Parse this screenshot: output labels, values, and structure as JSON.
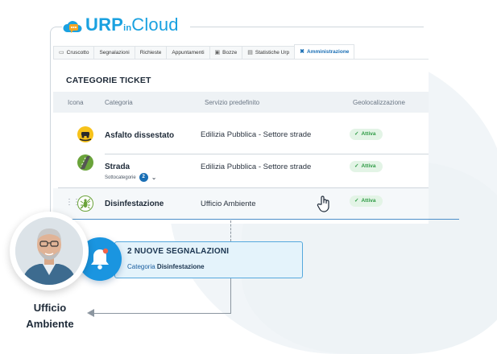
{
  "app": {
    "logo_urp": "URP",
    "logo_in": "in",
    "logo_cloud": "Cloud"
  },
  "tabs": [
    {
      "label": "Cruscotto",
      "icon": "monitor-icon"
    },
    {
      "label": "Segnalazioni",
      "icon": ""
    },
    {
      "label": "Richieste",
      "icon": ""
    },
    {
      "label": "Appuntamenti",
      "icon": ""
    },
    {
      "label": "Bozze",
      "icon": "draft-icon"
    },
    {
      "label": "Statistiche Urp",
      "icon": "stats-icon"
    },
    {
      "label": "Amministrazione",
      "icon": "tools-icon",
      "active": true
    }
  ],
  "section_title": "CATEGORIE TICKET",
  "table": {
    "headers": [
      "Icona",
      "Categoria",
      "Servizio predefinito",
      "Geolocalizzazione"
    ],
    "rows": [
      {
        "category": "Asfalto dissestato",
        "service": "Edilizia Pubblica - Settore strade",
        "status": "Attiva",
        "icon": "car-pothole-icon"
      },
      {
        "category": "Strada",
        "service": "Edilizia Pubblica - Settore strade",
        "status": "Attiva",
        "icon": "road-icon",
        "sub_label": "Sottocategorie",
        "sub_count": "2"
      },
      {
        "category": "Disinfestazione",
        "service": "Ufficio Ambiente",
        "status": "Attiva",
        "icon": "insect-icon"
      }
    ]
  },
  "notification": {
    "title": "2 NUOVE SEGNALAZIONI",
    "category_label": "Categoria",
    "category_value": "Disinfestazione"
  },
  "person": {
    "label_line1": "Ufficio",
    "label_line2": "Ambiente"
  },
  "colors": {
    "brand": "#1aa1e0",
    "accent": "#1a6fb5",
    "active_badge_bg": "#e3f4e6",
    "active_badge_text": "#2f9b46",
    "notification_bg": "#e4f3fb"
  }
}
